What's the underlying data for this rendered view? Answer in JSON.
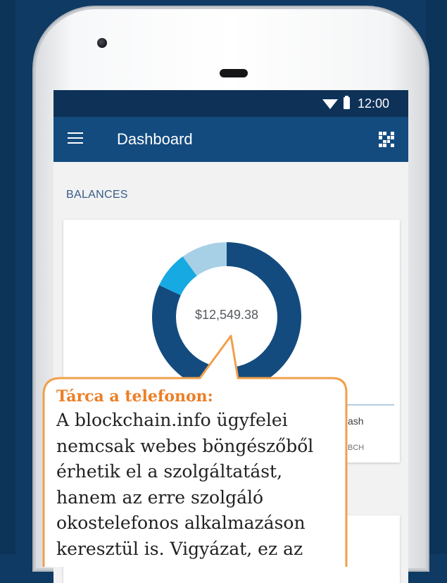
{
  "status_bar": {
    "time": "12:00"
  },
  "app_bar": {
    "title": "Dashboard"
  },
  "balances": {
    "section_label": "BALANCES",
    "total": "$12,549.38",
    "legend_partial_name": "ash",
    "legend_partial_code": "BCH"
  },
  "chart_data": {
    "type": "pie",
    "title": "",
    "center_label": "$12,549.38",
    "slices": [
      {
        "value": 0.82,
        "color": "#134b7f"
      },
      {
        "value": 0.08,
        "color": "#16a9e2"
      },
      {
        "value": 0.1,
        "color": "#a7d0e6"
      }
    ]
  },
  "callout": {
    "title": "Tárca a telefonon:",
    "lines": [
      "A blockchain.info ügyfelei",
      "nemcsak webes böngészőből",
      "érhetik el a szolgáltatást,",
      "hanem az erre szolgáló",
      "okostelefonos alkalmazáson",
      "keresztül is. Vigyázat, ez az"
    ]
  },
  "colors": {
    "background": "#0f3a63",
    "status_bar": "#0e3157",
    "app_bar": "#134b7f",
    "callout_border": "#f0a04b",
    "callout_title": "#ec7e25"
  }
}
